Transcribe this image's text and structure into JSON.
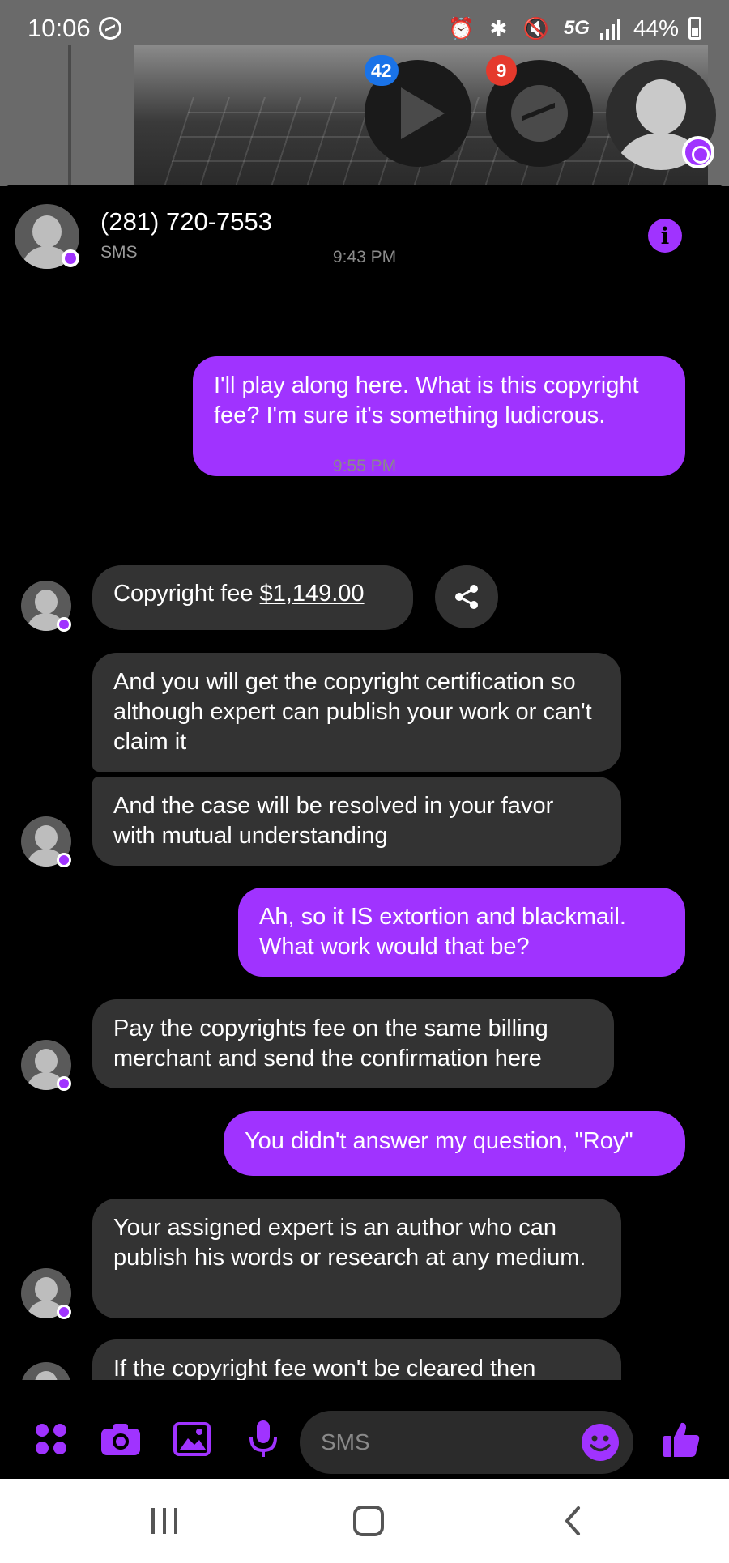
{
  "status_bar": {
    "time": "10:06",
    "network": "5G",
    "battery": "44%"
  },
  "chat_heads": {
    "video_badge": "42",
    "messenger_badge": "9"
  },
  "header": {
    "contact_name": "(281) 720-7553",
    "channel": "SMS"
  },
  "messages": {
    "ts1": "9:43 PM",
    "out1": "I'll play along here. What is this copyright fee? I'm sure it's something ludicrous.",
    "ts2": "9:55 PM",
    "in1_prefix": "Copyright fee ",
    "in1_amount": "$1,149.00",
    "in2": "And you will get the copyright certification so although expert can publish your work or can't claim it",
    "in3": "And the case will be resolved in your favor with mutual understanding",
    "out2": "Ah, so it IS extortion and blackmail. What work would that be?",
    "in4": "Pay the copyrights fee on the same billing merchant and send the confirmation here",
    "out3": "You didn't answer my question, \"Roy\"",
    "in5": "Your assigned expert is an author who can publish his words or research at any medium.",
    "in6": "If the copyright fee won't be cleared then"
  },
  "composer": {
    "placeholder": "SMS"
  },
  "colors": {
    "accent": "#a033ff",
    "incoming_bubble": "#333333",
    "background": "#000000"
  },
  "icons": [
    "apps-icon",
    "camera-icon",
    "gallery-icon",
    "microphone-icon",
    "emoji-icon",
    "thumbs-up-icon",
    "info-icon",
    "share-icon"
  ]
}
